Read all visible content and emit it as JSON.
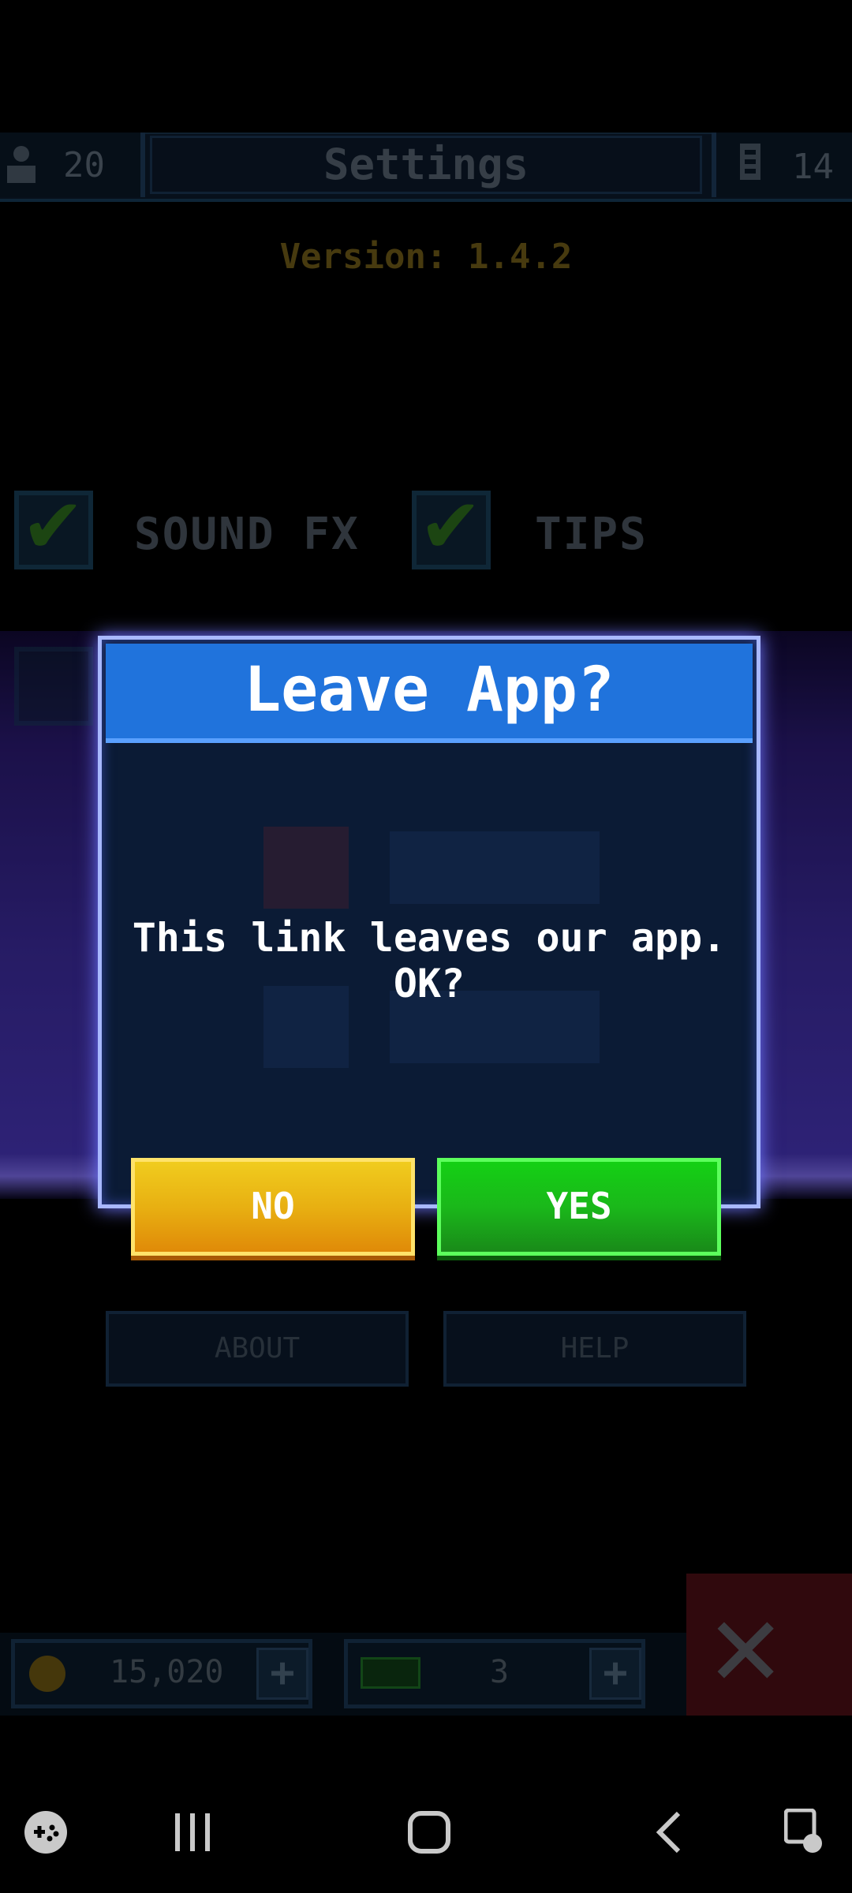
{
  "header": {
    "player_count": "20",
    "title": "Settings",
    "card_count": "14"
  },
  "version_text": "Version: 1.4.2",
  "options": {
    "sound_fx_label": "SOUND FX",
    "tips_label": "TIPS",
    "sound_fx_checked": true,
    "tips_checked": true
  },
  "social": {
    "google_state": "OFF",
    "facebook_state": "OFF"
  },
  "bottom_buttons": {
    "about_label": "ABOUT",
    "help_label": "HELP"
  },
  "currency": {
    "coins": "15,020",
    "gems": "3"
  },
  "dialog": {
    "title": "Leave App?",
    "message": "This link leaves our app. OK?",
    "no_label": "NO",
    "yes_label": "YES"
  },
  "colors": {
    "dialog_header": "#2073dc",
    "no_button": "#e8b012",
    "yes_button": "#1ab81a"
  },
  "icons": {
    "player": "person-icon",
    "cards": "card-icon",
    "coin": "coin-icon",
    "gem": "gem-icon",
    "exit": "close-icon",
    "nav_game": "gamepad-icon",
    "nav_recents": "recents-icon",
    "nav_home": "home-icon",
    "nav_back": "back-icon",
    "nav_assist": "accessibility-icon"
  }
}
